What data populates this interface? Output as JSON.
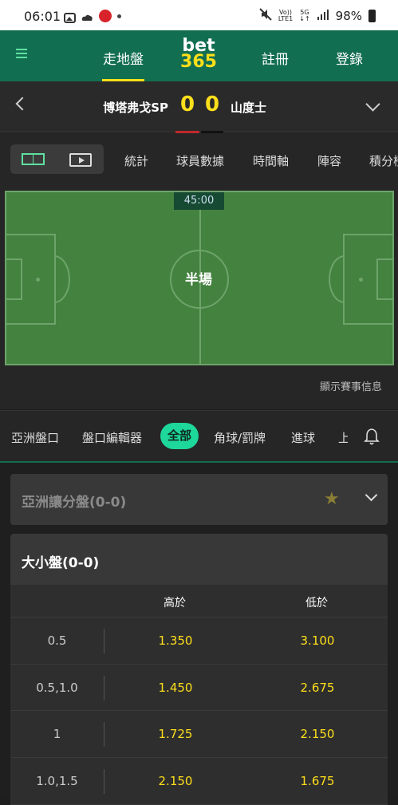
{
  "status": {
    "time": "06:01",
    "battery": "98%",
    "network": "5G",
    "volte": "Vo))\nLTE1"
  },
  "header": {
    "live": "走地盤",
    "logo_top": "bet",
    "logo_bottom": "365",
    "register": "註冊",
    "login": "登錄"
  },
  "match": {
    "home": "博塔弗戈SP",
    "away": "山度士",
    "home_score": "0",
    "away_score": "0"
  },
  "stat_tabs": [
    "統計",
    "球員數據",
    "時間軸",
    "陣容",
    "積分榜"
  ],
  "pitch": {
    "clock": "45:00",
    "status": "半場",
    "show_info": "顯示賽事信息"
  },
  "market_tabs": [
    "亞洲盤口",
    "盤口編輯器",
    "全部",
    "角球/罰牌",
    "進球",
    "上"
  ],
  "markets": {
    "asian_handicap_title": "亞洲讓分盤(0-0)",
    "totals_title": "大小盤(0-0)",
    "col_over": "高於",
    "col_under": "低於",
    "rows": [
      {
        "line": "0.5",
        "over": "1.350",
        "under": "3.100"
      },
      {
        "line": "0.5,1.0",
        "over": "1.450",
        "under": "2.675"
      },
      {
        "line": "1",
        "over": "1.725",
        "under": "2.150"
      },
      {
        "line": "1.0,1.5",
        "over": "2.150",
        "under": "1.675"
      }
    ]
  },
  "colors": {
    "header_green": "#126e51",
    "accent_yellow": "#ffdf1b",
    "active_tab": "#1ed79a"
  }
}
